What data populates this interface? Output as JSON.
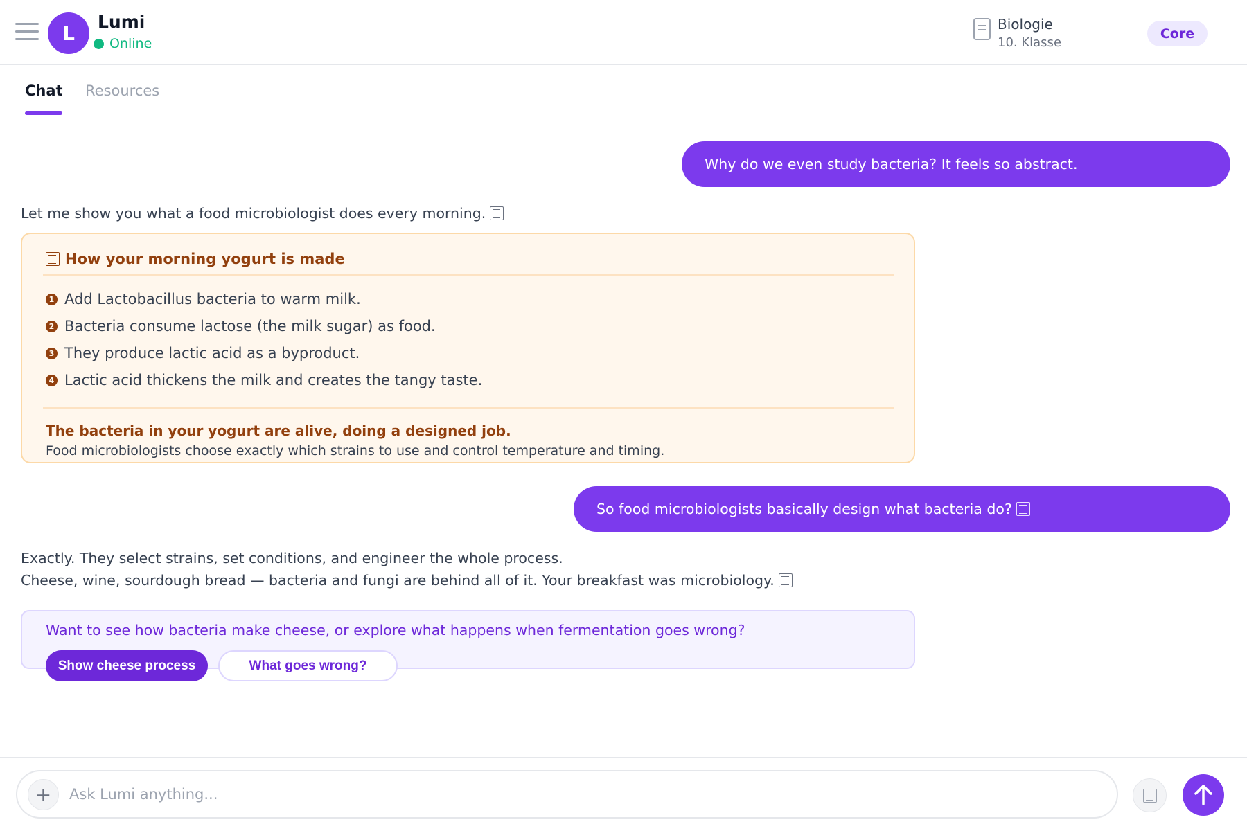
{
  "header": {
    "menu_icon": "hamburger-menu-icon",
    "avatar_letter": "L",
    "app_name": "Lumi",
    "status": "Online",
    "subject_icon": "document-icon",
    "subject": "Biologie",
    "grade": "10. Klasse",
    "tier": "Core"
  },
  "tabs": [
    {
      "label": "Chat",
      "active": true
    },
    {
      "label": "Resources",
      "active": false
    }
  ],
  "messages": {
    "user_1": "Why do we even study bacteria? It feels so abstract.",
    "ai_intro": "Let me show you what a food microbiologist does every morning.",
    "card": {
      "title": "How your morning yogurt is made",
      "steps": [
        "Add Lactobacillus bacteria to warm milk.",
        "Bacteria consume lactose (the milk sugar) as food.",
        "They produce lactic acid as a byproduct.",
        "Lactic acid thickens the milk and creates the tangy taste."
      ],
      "step_markers": [
        "1",
        "2",
        "3",
        "4"
      ],
      "summary": "The bacteria in your yogurt are alive, doing a designed job.",
      "detail": "Food microbiologists choose exactly which strains to use and control temperature and timing."
    },
    "user_2": "So food microbiologists basically design what bacteria do?",
    "ai_reply_line1": "Exactly. They select strains, set conditions, and engineer the whole process.",
    "ai_reply_line2": "Cheese, wine, sourdough bread — bacteria and fungi are behind all of it. Your breakfast was microbiology.",
    "followup": {
      "question": "Want to see how bacteria make cheese, or explore what happens when fermentation goes wrong?",
      "primary_label": "Show cheese process",
      "secondary_label": "What goes wrong?"
    }
  },
  "composer": {
    "placeholder": "Ask Lumi anything...",
    "attach_icon": "plus-icon",
    "voice_icon": "microphone-icon",
    "send_icon": "arrow-up-icon"
  },
  "colors": {
    "accent": "#7c3aed",
    "online": "#10b981",
    "card_bg": "#fff7ed",
    "card_title": "#92400e"
  }
}
